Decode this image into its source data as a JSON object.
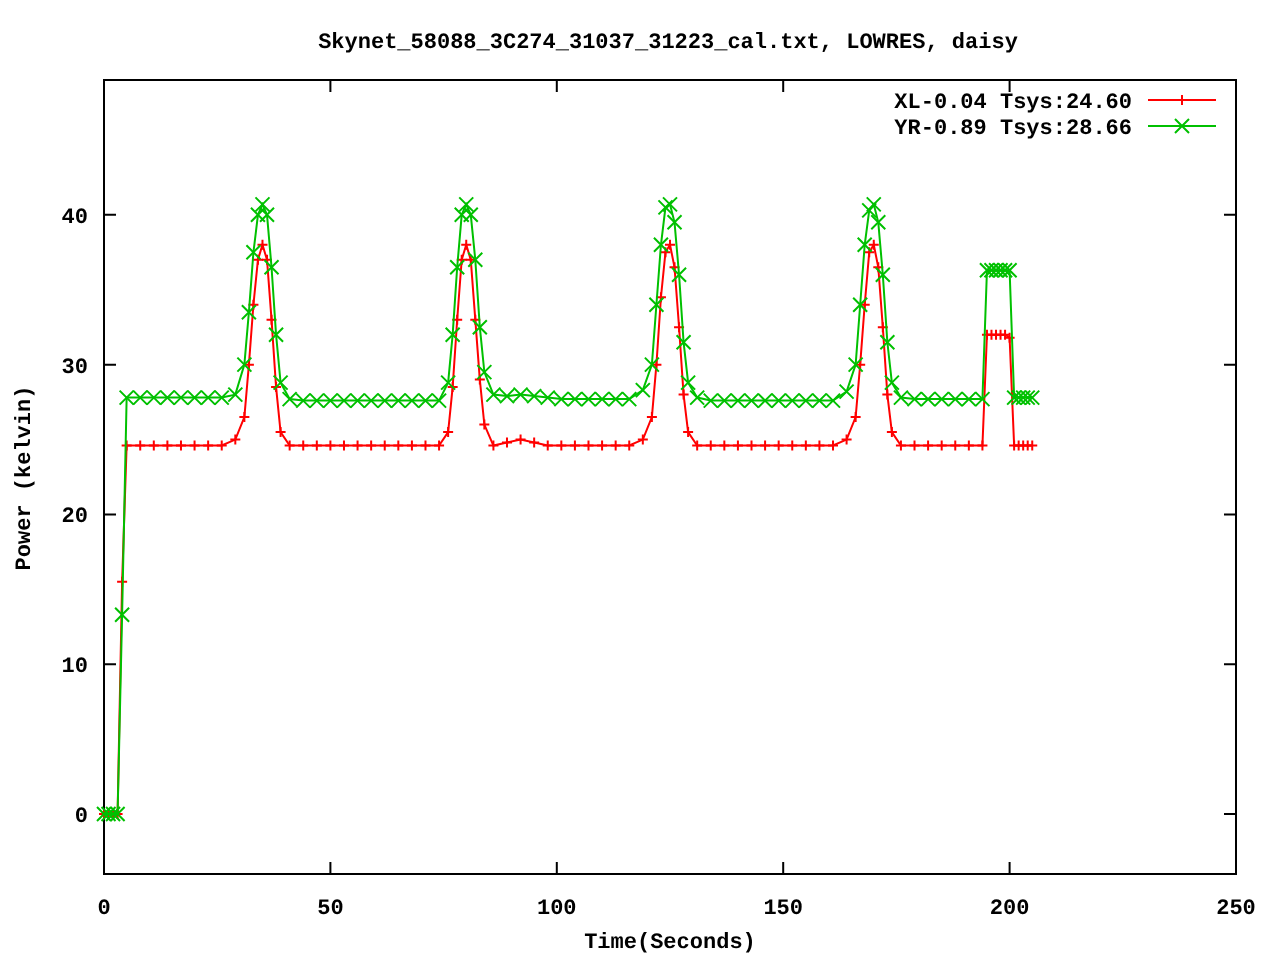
{
  "chart_data": {
    "type": "line",
    "title": "Skynet_58088_3C274_31037_31223_cal.txt, LOWRES, daisy",
    "xlabel": "Time(Seconds)",
    "ylabel": "Power (kelvin)",
    "x": [
      0,
      1,
      2,
      3,
      4,
      5,
      8,
      11,
      14,
      17,
      20,
      23,
      26,
      29,
      31,
      32,
      33,
      34,
      35,
      36,
      37,
      38,
      39,
      41,
      44,
      47,
      50,
      53,
      56,
      59,
      62,
      65,
      68,
      71,
      74,
      76,
      77,
      78,
      79,
      80,
      81,
      82,
      83,
      84,
      86,
      89,
      92,
      95,
      98,
      101,
      104,
      107,
      110,
      113,
      116,
      119,
      121,
      122,
      123,
      124,
      125,
      126,
      127,
      128,
      129,
      131,
      134,
      137,
      140,
      143,
      146,
      149,
      152,
      155,
      158,
      161,
      164,
      166,
      167,
      168,
      169,
      170,
      171,
      172,
      173,
      174,
      176,
      179,
      182,
      185,
      188,
      191,
      194,
      195,
      196,
      197,
      198,
      199,
      200,
      201,
      202,
      203,
      204,
      205
    ],
    "series": [
      {
        "name": "XL-0.04 Tsys:24.60",
        "color": "#ff0000",
        "marker": "plus",
        "values": [
          0,
          0,
          0,
          0,
          15.5,
          24.6,
          24.6,
          24.6,
          24.6,
          24.6,
          24.6,
          24.6,
          24.6,
          25,
          26.5,
          30,
          34,
          37,
          38,
          37,
          33,
          28.5,
          25.5,
          24.6,
          24.6,
          24.6,
          24.6,
          24.6,
          24.6,
          24.6,
          24.6,
          24.6,
          24.6,
          24.6,
          24.6,
          25.5,
          28.5,
          33,
          37,
          38,
          37,
          33,
          29,
          26,
          24.6,
          24.8,
          25,
          24.8,
          24.6,
          24.6,
          24.6,
          24.6,
          24.6,
          24.6,
          24.6,
          25,
          26.5,
          30,
          34.5,
          37.5,
          38,
          36.5,
          32.5,
          28,
          25.5,
          24.6,
          24.6,
          24.6,
          24.6,
          24.6,
          24.6,
          24.6,
          24.6,
          24.6,
          24.6,
          24.6,
          25,
          26.5,
          30,
          34,
          37.5,
          38,
          36.5,
          32.5,
          28,
          25.5,
          24.6,
          24.6,
          24.6,
          24.6,
          24.6,
          24.6,
          24.6,
          32,
          32,
          32,
          32,
          32,
          31.8,
          24.6,
          24.6,
          24.6,
          24.6,
          24.6
        ]
      },
      {
        "name": "YR-0.89 Tsys:28.66",
        "color": "#00c000",
        "marker": "cross",
        "values": [
          0,
          0,
          0,
          0,
          13.3,
          27.8,
          27.8,
          27.8,
          27.8,
          27.8,
          27.8,
          27.8,
          27.8,
          28,
          30,
          33.5,
          37.5,
          40,
          40.7,
          40,
          36.5,
          32,
          28.8,
          27.7,
          27.6,
          27.6,
          27.6,
          27.6,
          27.6,
          27.6,
          27.6,
          27.6,
          27.6,
          27.6,
          27.6,
          28.8,
          32,
          36.5,
          40,
          40.7,
          40,
          37,
          32.5,
          29.5,
          28,
          27.9,
          28,
          27.9,
          27.8,
          27.7,
          27.7,
          27.7,
          27.7,
          27.7,
          27.7,
          28.3,
          30,
          34,
          38,
          40.5,
          40.7,
          39.5,
          36,
          31.5,
          28.8,
          27.8,
          27.6,
          27.6,
          27.6,
          27.6,
          27.6,
          27.6,
          27.6,
          27.6,
          27.6,
          27.6,
          28.2,
          30,
          34,
          38,
          40.3,
          40.7,
          39.5,
          36,
          31.5,
          28.8,
          27.8,
          27.7,
          27.7,
          27.7,
          27.7,
          27.7,
          27.7,
          36.3,
          36.3,
          36.3,
          36.3,
          36.3,
          36.3,
          27.8,
          27.8,
          27.8,
          27.8,
          27.8
        ]
      }
    ],
    "legend": true,
    "xlim": [
      0,
      250
    ],
    "ylim": [
      -4,
      49
    ],
    "xticks": [
      0,
      50,
      100,
      150,
      200,
      250
    ],
    "yticks": [
      0,
      10,
      20,
      30,
      40
    ]
  }
}
